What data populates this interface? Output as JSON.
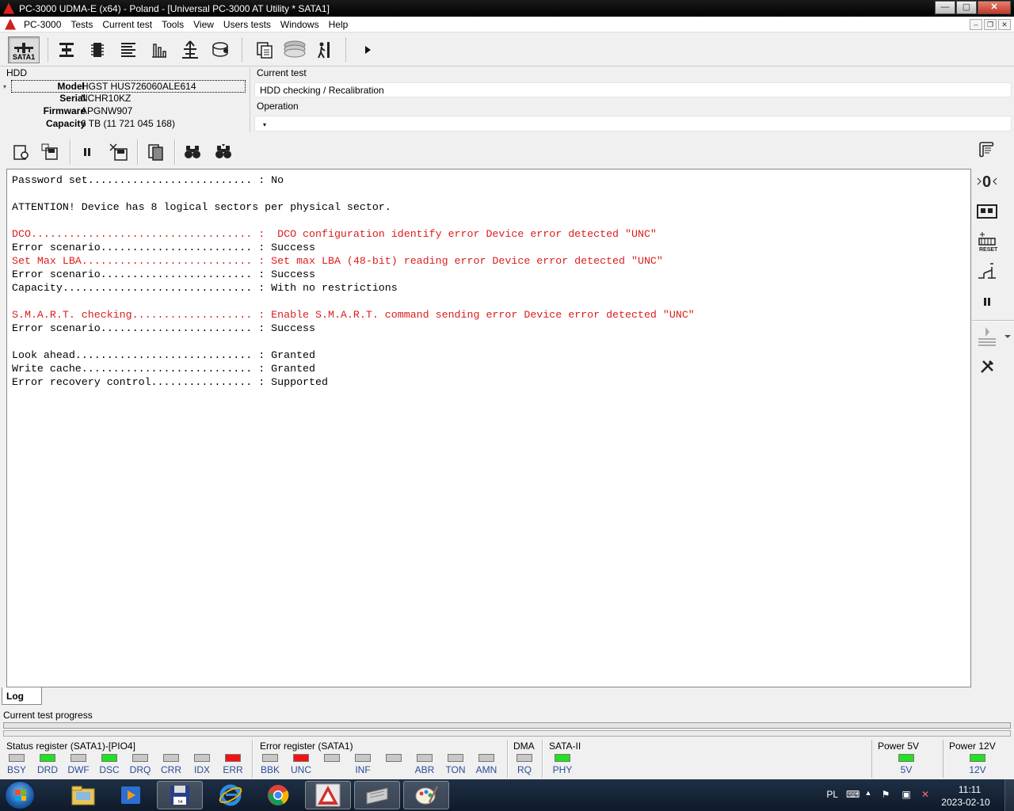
{
  "window": {
    "title": "PC-3000 UDMA-E (x64) - Poland - [Universal PC-3000 AT Utility * SATA1]",
    "buttons": {
      "minimize": "—",
      "maximize": "▢",
      "close": "✕"
    }
  },
  "menu": {
    "items": [
      "PC-3000",
      "Tests",
      "Current test",
      "Tools",
      "View",
      "Users tests",
      "Windows",
      "Help"
    ],
    "mdi": {
      "minimize": "–",
      "restore": "❐",
      "close": "✕"
    }
  },
  "toolbar": {
    "active_port": "SATA1",
    "icons": [
      "sata-port-icon",
      "drive-head-icon",
      "chip-icon",
      "list-icon",
      "chart-icon",
      "tree-icon",
      "disk-icon",
      "copy-icon",
      "stack-icon",
      "walk-icon",
      "play-icon"
    ]
  },
  "hdd": {
    "title": "HDD",
    "fields": [
      {
        "key": "Model",
        "value": "HGST HUS726060ALE614"
      },
      {
        "key": "Serial",
        "value": "NCHR10KZ"
      },
      {
        "key": "Firmware",
        "value": "APGNW907"
      },
      {
        "key": "Capacity",
        "value": "6 TB (11 721 045 168)"
      }
    ]
  },
  "current_test": {
    "label": "Current test",
    "value": "HDD checking / Recalibration",
    "operation_label": "Operation",
    "operation_value": ""
  },
  "log": {
    "lines": [
      {
        "text": "Password set.......................... : No",
        "error": false
      },
      {
        "text": "",
        "error": false
      },
      {
        "text": "ATTENTION! Device has 8 logical sectors per physical sector.",
        "error": false
      },
      {
        "text": "",
        "error": false
      },
      {
        "text": "DCO................................... :  DCO configuration identify error Device error detected \"UNC\"",
        "error": true
      },
      {
        "text": "Error scenario........................ : Success",
        "error": false
      },
      {
        "text": "Set Max LBA........................... : Set max LBA (48-bit) reading error Device error detected \"UNC\"",
        "error": true
      },
      {
        "text": "Error scenario........................ : Success",
        "error": false
      },
      {
        "text": "Capacity.............................. : With no restrictions",
        "error": false
      },
      {
        "text": "",
        "error": false
      },
      {
        "text": "S.M.A.R.T. checking................... : Enable S.M.A.R.T. command sending error Device error detected \"UNC\"",
        "error": true
      },
      {
        "text": "Error scenario........................ : Success",
        "error": false
      },
      {
        "text": "",
        "error": false
      },
      {
        "text": "Look ahead............................ : Granted",
        "error": false
      },
      {
        "text": "Write cache........................... : Granted",
        "error": false
      },
      {
        "text": "Error recovery control................ : Supported",
        "error": false
      }
    ],
    "tab_label": "Log"
  },
  "progress": {
    "label": "Current test progress",
    "value": 0
  },
  "registers": {
    "status_title": "Status register (SATA1)-[PIO4]",
    "status": [
      {
        "name": "BSY",
        "state": "gray"
      },
      {
        "name": "DRD",
        "state": "green"
      },
      {
        "name": "DWF",
        "state": "gray"
      },
      {
        "name": "DSC",
        "state": "green"
      },
      {
        "name": "DRQ",
        "state": "gray"
      },
      {
        "name": "CRR",
        "state": "gray"
      },
      {
        "name": "IDX",
        "state": "gray"
      },
      {
        "name": "ERR",
        "state": "red"
      }
    ],
    "error_title": "Error register (SATA1)",
    "error": [
      {
        "name": "BBK",
        "state": "gray"
      },
      {
        "name": "UNC",
        "state": "red"
      },
      {
        "name": "",
        "state": "gray"
      },
      {
        "name": "INF",
        "state": "gray"
      },
      {
        "name": "",
        "state": "gray"
      },
      {
        "name": "ABR",
        "state": "gray"
      },
      {
        "name": "TON",
        "state": "gray"
      },
      {
        "name": "AMN",
        "state": "gray"
      }
    ],
    "dma_title": "DMA",
    "dma": {
      "name": "RQ",
      "state": "gray"
    },
    "sata_title": "SATA-II",
    "sata": {
      "name": "PHY",
      "state": "green"
    },
    "power5_title": "Power 5V",
    "power5": {
      "name": "5V",
      "state": "green"
    },
    "power12_title": "Power 12V",
    "power12": {
      "name": "12V",
      "state": "green"
    }
  },
  "taskbar": {
    "apps": [
      "explorer-icon",
      "media-player-icon",
      "floppy-icon",
      "ie-icon",
      "chrome-icon",
      "pc3000-icon",
      "scanner-icon",
      "paint-icon"
    ],
    "language": "PL",
    "time": "11:11",
    "date": "2023-02-10"
  }
}
